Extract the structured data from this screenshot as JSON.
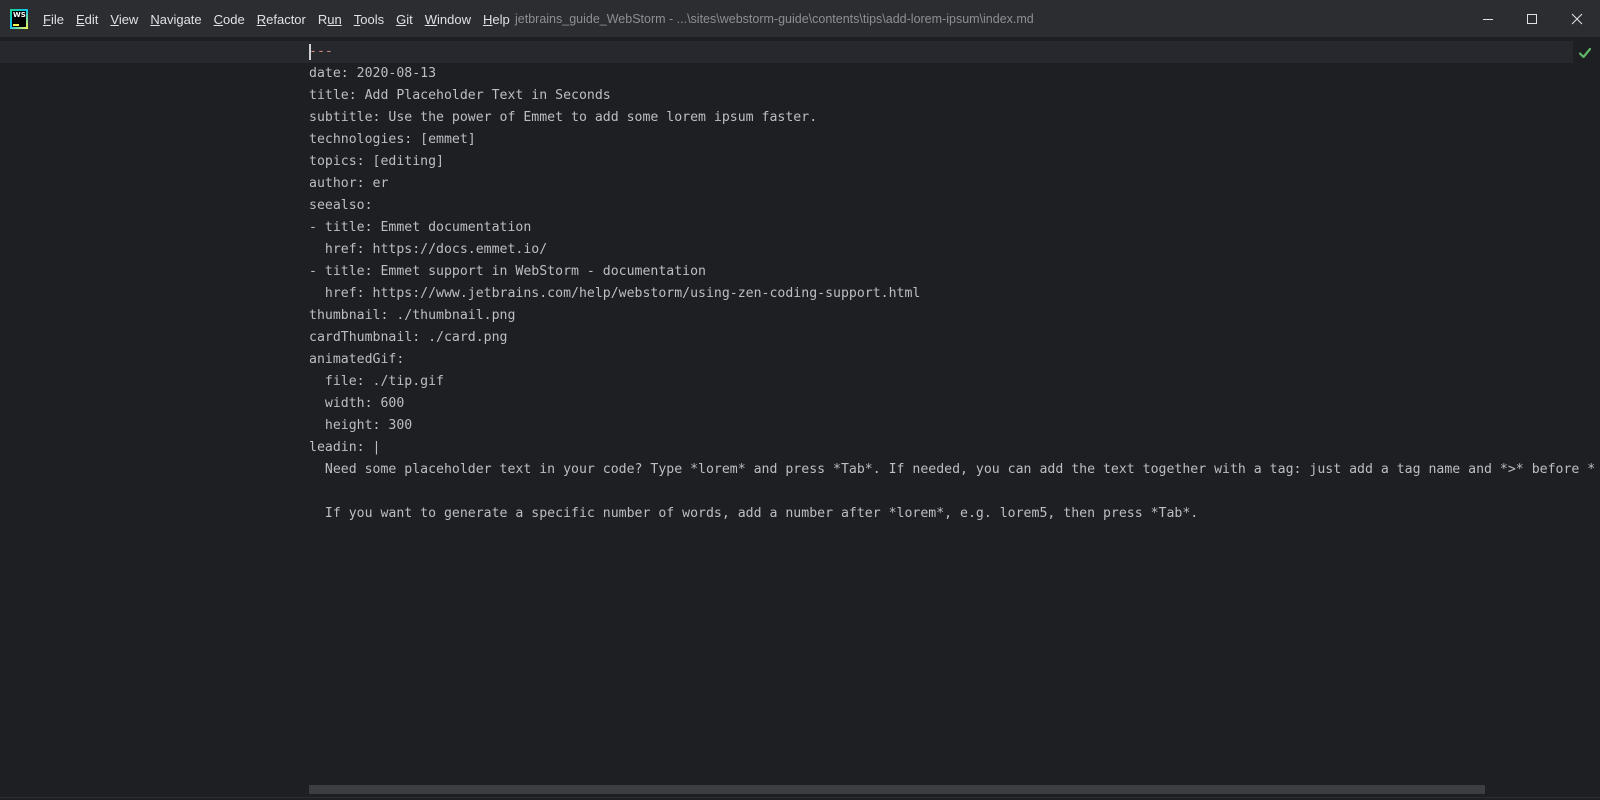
{
  "app": {
    "logo_text": "WS",
    "window_title": "jetbrains_guide_WebStorm - ...\\sites\\webstorm-guide\\contents\\tips\\add-lorem-ipsum\\index.md"
  },
  "menu": {
    "items": [
      {
        "mnemonic": "F",
        "rest": "ile"
      },
      {
        "mnemonic": "E",
        "rest": "dit"
      },
      {
        "mnemonic": "V",
        "rest": "iew"
      },
      {
        "mnemonic": "N",
        "rest": "avigate"
      },
      {
        "mnemonic": "C",
        "rest": "ode"
      },
      {
        "mnemonic": "R",
        "rest": "efactor"
      },
      {
        "mnemonic": "R",
        "rest": "un",
        "underline_index": 1
      },
      {
        "mnemonic": "T",
        "rest": "ools"
      },
      {
        "mnemonic": "G",
        "rest": "it"
      },
      {
        "mnemonic": "W",
        "rest": "indow"
      },
      {
        "mnemonic": "H",
        "rest": "elp"
      }
    ]
  },
  "window_controls": {
    "minimize_icon": "minimize-icon",
    "maximize_icon": "maximize-icon",
    "close_icon": "close-icon"
  },
  "editor": {
    "inspection_status_icon": "checkmark-icon",
    "lines": [
      "---",
      "date: 2020-08-13",
      "title: Add Placeholder Text in Seconds",
      "subtitle: Use the power of Emmet to add some lorem ipsum faster.",
      "technologies: [emmet]",
      "topics: [editing]",
      "author: er",
      "seealso:",
      "- title: Emmet documentation",
      "  href: https://docs.emmet.io/",
      "- title: Emmet support in WebStorm - documentation",
      "  href: https://www.jetbrains.com/help/webstorm/using-zen-coding-support.html",
      "thumbnail: ./thumbnail.png",
      "cardThumbnail: ./card.png",
      "animatedGif:",
      "  file: ./tip.gif",
      "  width: 600",
      "  height: 300",
      "leadin: |",
      "  Need some placeholder text in your code? Type *lorem* and press *Tab*. If needed, you can add the text together with a tag: just add a tag name and *>* before *",
      "",
      "  If you want to generate a specific number of words, add a number after *lorem*, e.g. lorem5, then press *Tab*."
    ]
  },
  "colors": {
    "background": "#1e1f22",
    "titlebar": "#2b2d30",
    "text": "#bcbec4",
    "frontmatter_delimiter": "#cf8e6d",
    "ok_check": "#5fb865"
  }
}
